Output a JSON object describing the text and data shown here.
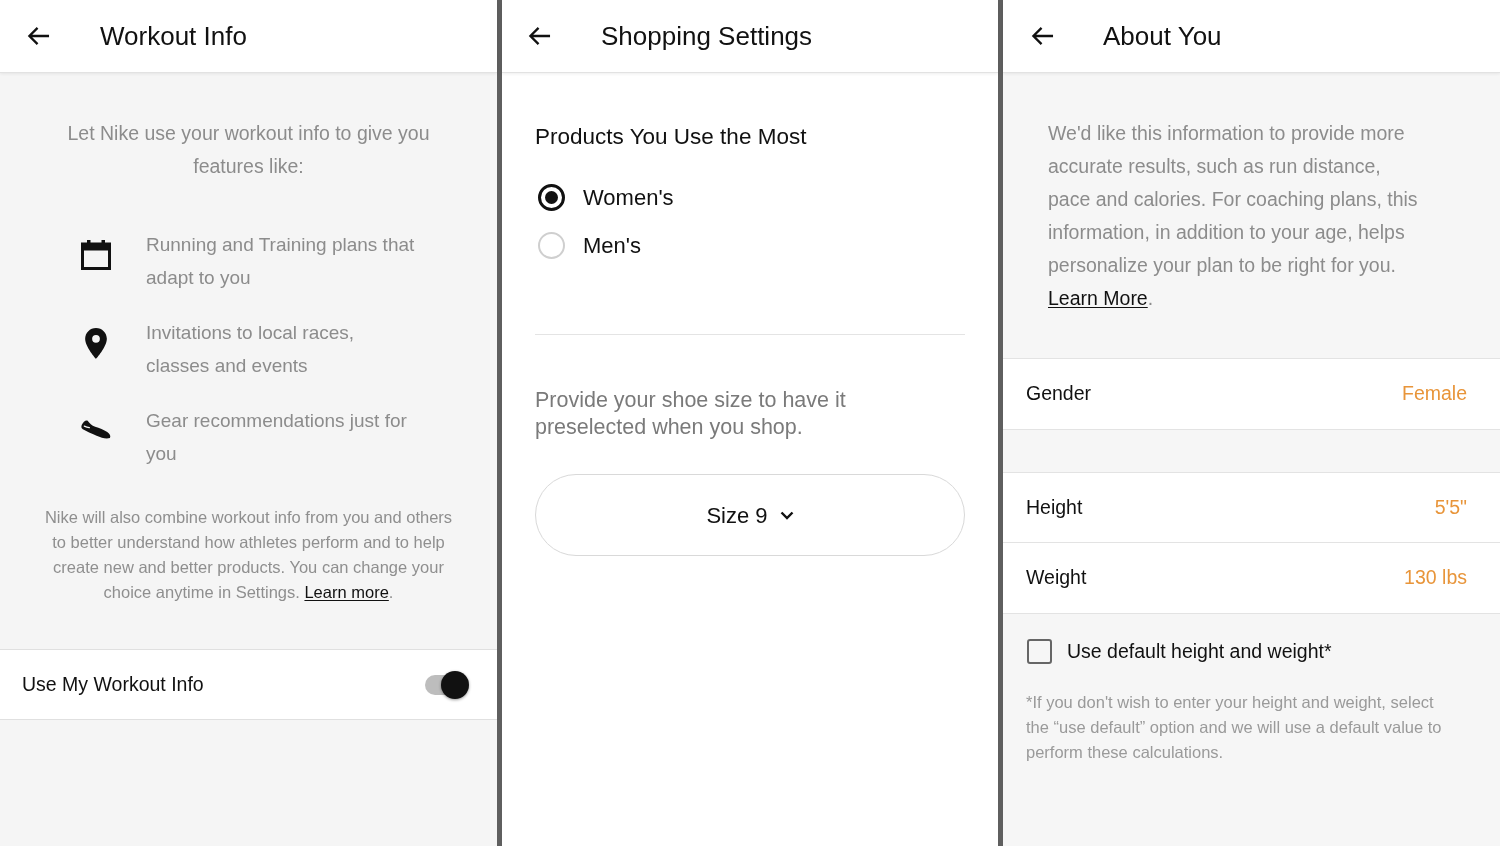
{
  "workout_info": {
    "title": "Workout Info",
    "intro": "Let Nike use your workout info to give you features like:",
    "features": [
      {
        "kind": "calendar",
        "text": "Running and Training plans that adapt to you"
      },
      {
        "kind": "location",
        "text": "Invitations to local races, classes and events"
      },
      {
        "kind": "shoe",
        "text": "Gear recommendations just for you"
      }
    ],
    "note": {
      "text": "Nike will also combine workout info from you and others to better understand how athletes perform and to help create new and better products. You can change your choice anytime in Settings.",
      "link": "Learn more",
      "after": "."
    },
    "toggle": {
      "label": "Use My Workout Info",
      "on": true
    }
  },
  "shopping_settings": {
    "title": "Shopping Settings",
    "products_heading": "Products You Use the Most",
    "options": [
      {
        "label": "Women's",
        "selected": true
      },
      {
        "label": "Men's",
        "selected": false
      }
    ],
    "shoe_size_prompt": "Provide your shoe size to have it preselected when you shop.",
    "size_button": "Size 9"
  },
  "about_you": {
    "title": "About You",
    "intro": {
      "text": "We'd like this information to provide more accurate results, such as run distance, pace and calories. For coaching plans, this information, in addition to your age, helps personalize your plan to be right for you.",
      "link": "Learn More",
      "after": "."
    },
    "field_groups": [
      {
        "rows": [
          {
            "label": "Gender",
            "value": "Female"
          }
        ]
      },
      {
        "rows": [
          {
            "label": "Height",
            "value": "5'5\""
          },
          {
            "label": "Weight",
            "value": "130 lbs"
          }
        ]
      }
    ],
    "checkbox": {
      "label": "Use default height and weight*",
      "checked": false
    },
    "footnote": "*If you don't wish to enter your height and weight, select the “use default” option and we will use a default value to perform these calculations."
  }
}
